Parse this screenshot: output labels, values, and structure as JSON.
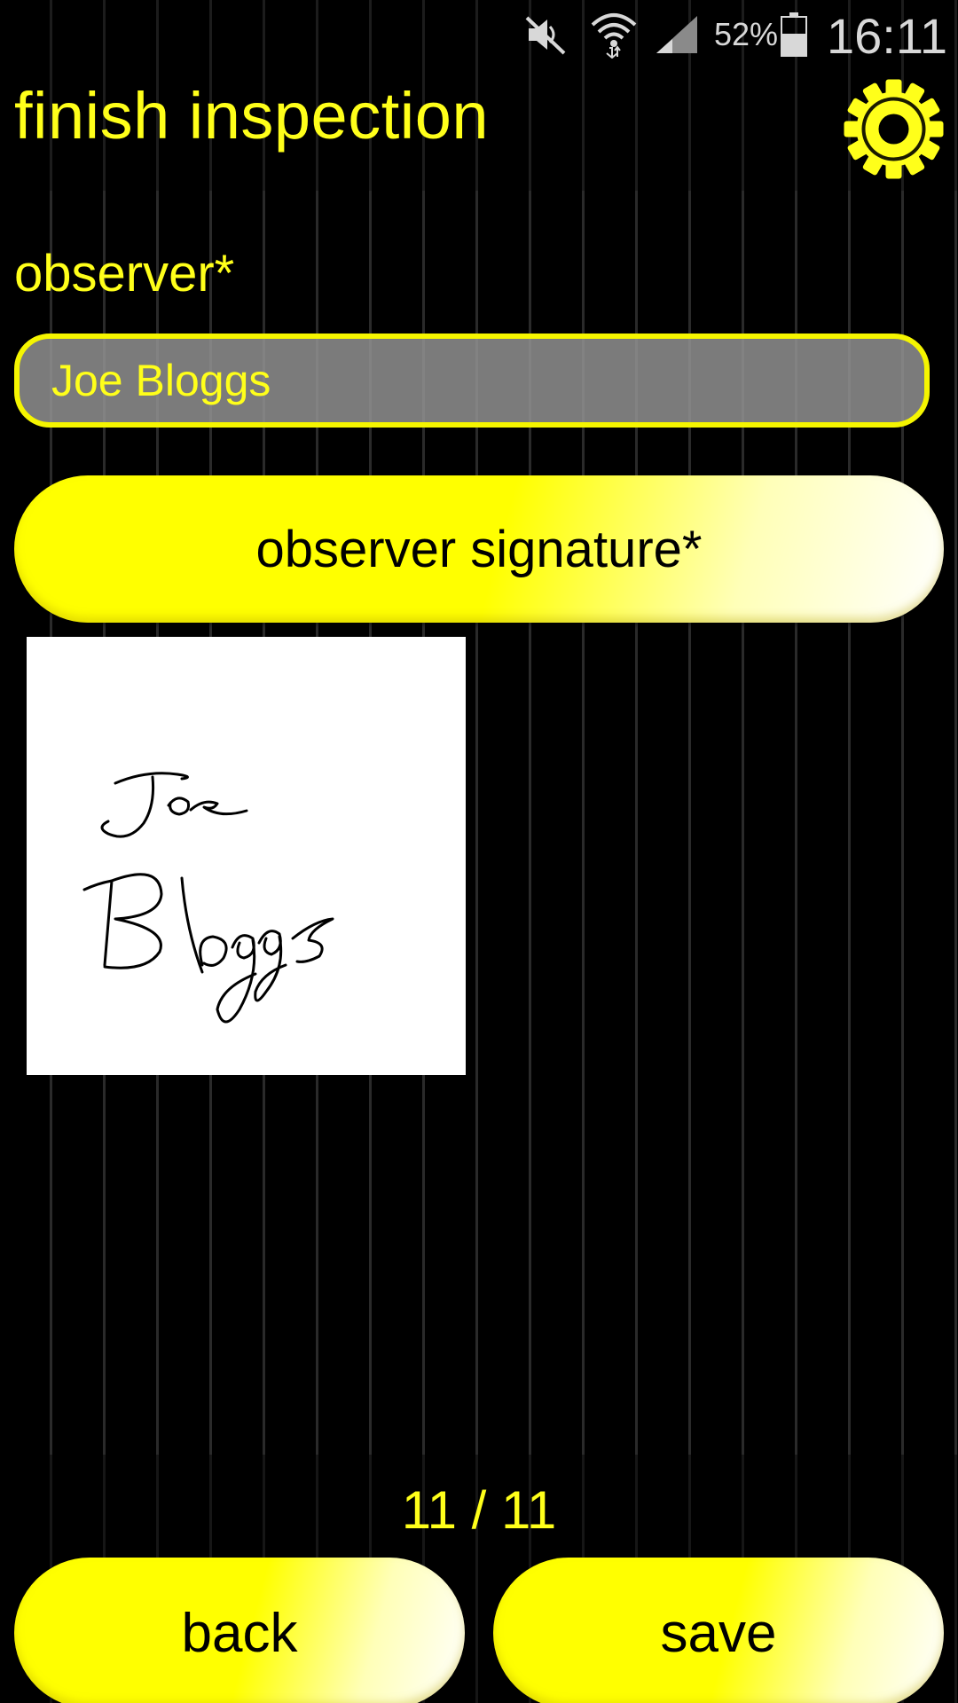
{
  "status_bar": {
    "battery_percent": "52%",
    "time": "16:11",
    "icons": [
      "mute-icon",
      "wifi-icon",
      "signal-icon",
      "battery-icon"
    ]
  },
  "header": {
    "title": "finish inspection",
    "settings_icon": "gear-icon"
  },
  "form": {
    "observer_label": "observer*",
    "observer_value": "Joe Bloggs",
    "signature_button_label": "observer signature*",
    "signature_text": "Joe Bloggs"
  },
  "pagination": {
    "current": 11,
    "total": 11,
    "label": "11 / 11"
  },
  "footer": {
    "back_label": "back",
    "save_label": "save"
  },
  "colors": {
    "accent": "#ffff1a",
    "background": "#000000",
    "input_fill": "#969696"
  }
}
